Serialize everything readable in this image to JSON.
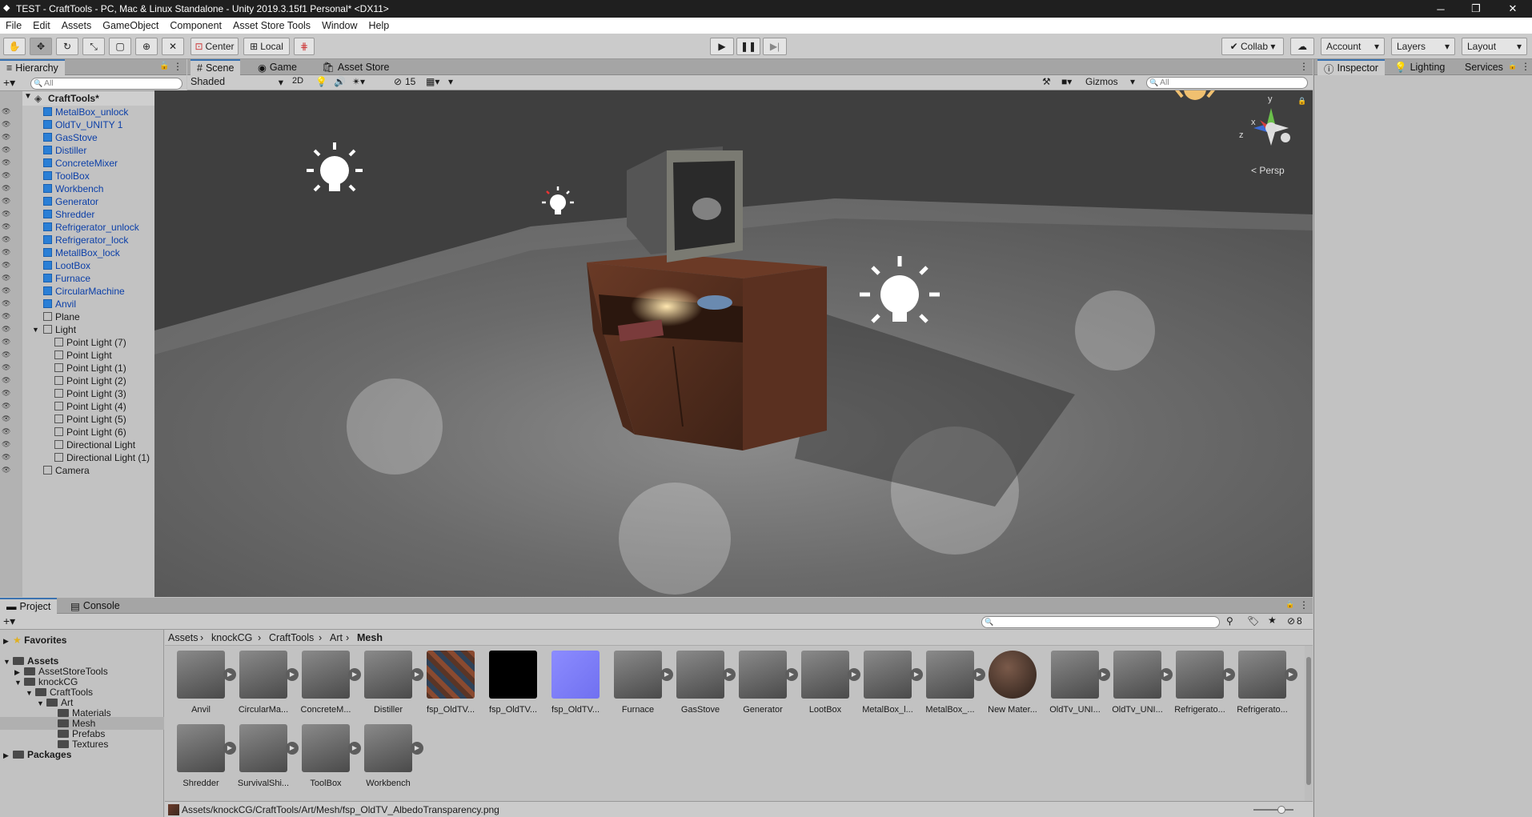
{
  "titlebar": {
    "title": "TEST - CraftTools - PC, Mac & Linux Standalone - Unity 2019.3.15f1 Personal* <DX11>",
    "minimize": "─",
    "maximize": "❐",
    "close": "✕"
  },
  "menu": [
    "File",
    "Edit",
    "Assets",
    "GameObject",
    "Component",
    "Asset Store Tools",
    "Window",
    "Help"
  ],
  "toolbar": {
    "center": "Center",
    "local": "Local",
    "collab": "Collab",
    "account": "Account",
    "layers": "Layers",
    "layout": "Layout"
  },
  "hierarchy": {
    "tab": "Hierarchy",
    "search_placeholder": "All",
    "root": "CraftTools*",
    "items": [
      {
        "label": "MetalBox_unlock",
        "prefab": true,
        "indent": 1,
        "arrow": true
      },
      {
        "label": "OldTv_UNITY 1",
        "prefab": true,
        "indent": 1,
        "arrow": false
      },
      {
        "label": "GasStove",
        "prefab": true,
        "indent": 1,
        "arrow": true
      },
      {
        "label": "Distiller",
        "prefab": true,
        "indent": 1,
        "arrow": true
      },
      {
        "label": "ConcreteMixer",
        "prefab": true,
        "indent": 1,
        "arrow": true
      },
      {
        "label": "ToolBox",
        "prefab": true,
        "indent": 1,
        "arrow": true
      },
      {
        "label": "Workbench",
        "prefab": true,
        "indent": 1,
        "arrow": true
      },
      {
        "label": "Generator",
        "prefab": true,
        "indent": 1,
        "arrow": true
      },
      {
        "label": "Shredder",
        "prefab": true,
        "indent": 1,
        "arrow": true
      },
      {
        "label": "Refrigerator_unlock",
        "prefab": true,
        "indent": 1,
        "arrow": true
      },
      {
        "label": "Refrigerator_lock",
        "prefab": true,
        "indent": 1,
        "arrow": true
      },
      {
        "label": "MetallBox_lock",
        "prefab": true,
        "indent": 1,
        "arrow": true
      },
      {
        "label": "LootBox",
        "prefab": true,
        "indent": 1,
        "arrow": true
      },
      {
        "label": "Furnace",
        "prefab": true,
        "indent": 1,
        "arrow": true
      },
      {
        "label": "CircularMachine",
        "prefab": true,
        "indent": 1,
        "arrow": true
      },
      {
        "label": "Anvil",
        "prefab": true,
        "indent": 1,
        "arrow": true
      },
      {
        "label": "Plane",
        "prefab": false,
        "indent": 1,
        "arrow": false
      },
      {
        "label": "Light",
        "prefab": false,
        "indent": 1,
        "arrow": false,
        "expanded": true
      },
      {
        "label": "Point Light (7)",
        "prefab": false,
        "indent": 2,
        "arrow": false
      },
      {
        "label": "Point Light",
        "prefab": false,
        "indent": 2,
        "arrow": false
      },
      {
        "label": "Point Light (1)",
        "prefab": false,
        "indent": 2,
        "arrow": false
      },
      {
        "label": "Point Light (2)",
        "prefab": false,
        "indent": 2,
        "arrow": false
      },
      {
        "label": "Point Light (3)",
        "prefab": false,
        "indent": 2,
        "arrow": false
      },
      {
        "label": "Point Light (4)",
        "prefab": false,
        "indent": 2,
        "arrow": false
      },
      {
        "label": "Point Light (5)",
        "prefab": false,
        "indent": 2,
        "arrow": false
      },
      {
        "label": "Point Light (6)",
        "prefab": false,
        "indent": 2,
        "arrow": false
      },
      {
        "label": "Directional Light",
        "prefab": false,
        "indent": 2,
        "arrow": false
      },
      {
        "label": "Directional Light (1)",
        "prefab": false,
        "indent": 2,
        "arrow": false
      },
      {
        "label": "Camera",
        "prefab": false,
        "indent": 1,
        "arrow": false
      }
    ]
  },
  "scene": {
    "tabs": [
      "Scene",
      "Game",
      "Asset Store"
    ],
    "shading": "Shaded",
    "mode_2d": "2D",
    "hidden_count": "15",
    "gizmos": "Gizmos",
    "search_placeholder": "All",
    "persp": "Persp",
    "axis_y": "y",
    "axis_x": "x",
    "axis_z": "z"
  },
  "inspector": {
    "tabs": [
      "Inspector",
      "Lighting",
      "Services"
    ]
  },
  "project": {
    "tabs": [
      "Project",
      "Console"
    ],
    "count": "8",
    "breadcrumb": [
      "Assets",
      "knockCG",
      "CraftTools",
      "Art",
      "Mesh"
    ],
    "sidebar": [
      {
        "label": "Favorites",
        "bold": true,
        "indent": 0
      },
      {
        "label": "Assets",
        "bold": true,
        "indent": 0
      },
      {
        "label": "AssetStoreTools",
        "indent": 1
      },
      {
        "label": "knockCG",
        "indent": 1
      },
      {
        "label": "CraftTools",
        "indent": 2
      },
      {
        "label": "Art",
        "indent": 3
      },
      {
        "label": "Materials",
        "indent": 4
      },
      {
        "label": "Mesh",
        "indent": 4,
        "selected": true
      },
      {
        "label": "Prefabs",
        "indent": 4
      },
      {
        "label": "Textures",
        "indent": 4
      },
      {
        "label": "Packages",
        "bold": true,
        "indent": 0
      }
    ],
    "assets": [
      {
        "label": "Anvil",
        "kind": "model"
      },
      {
        "label": "CircularMa...",
        "kind": "model"
      },
      {
        "label": "ConcreteM...",
        "kind": "model"
      },
      {
        "label": "Distiller",
        "kind": "model"
      },
      {
        "label": "fsp_OldTV...",
        "kind": "tex-color"
      },
      {
        "label": "fsp_OldTV...",
        "kind": "tex-black"
      },
      {
        "label": "fsp_OldTV...",
        "kind": "tex-normal"
      },
      {
        "label": "Furnace",
        "kind": "model"
      },
      {
        "label": "GasStove",
        "kind": "model"
      },
      {
        "label": "Generator",
        "kind": "model"
      },
      {
        "label": "LootBox",
        "kind": "model"
      },
      {
        "label": "MetalBox_l...",
        "kind": "model"
      },
      {
        "label": "MetalBox_...",
        "kind": "model"
      },
      {
        "label": "New Mater...",
        "kind": "material"
      },
      {
        "label": "OldTv_UNI...",
        "kind": "model"
      },
      {
        "label": "OldTv_UNI...",
        "kind": "model"
      },
      {
        "label": "Refrigerato...",
        "kind": "model"
      },
      {
        "label": "Refrigerato...",
        "kind": "model"
      },
      {
        "label": "Shredder",
        "kind": "model"
      },
      {
        "label": "SurvivalShi...",
        "kind": "model"
      },
      {
        "label": "ToolBox",
        "kind": "model"
      },
      {
        "label": "Workbench",
        "kind": "model"
      }
    ],
    "status_path": "Assets/knockCG/CraftTools/Art/Mesh/fsp_OldTV_AlbedoTransparency.png"
  }
}
